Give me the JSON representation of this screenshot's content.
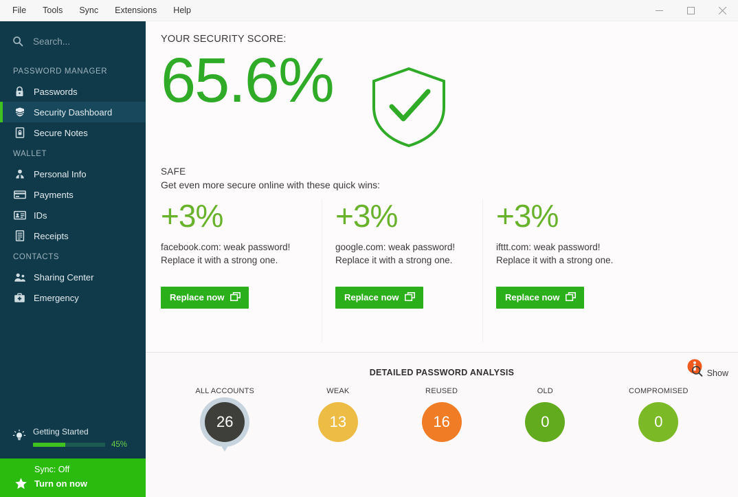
{
  "window": {
    "menu": [
      "File",
      "Tools",
      "Sync",
      "Extensions",
      "Help"
    ],
    "controls": {
      "minimize": "minimize-button",
      "maximize": "maximize-button",
      "close": "close-button"
    }
  },
  "sidebar": {
    "search": {
      "value": "",
      "placeholder": "Search..."
    },
    "sections": [
      {
        "title": "PASSWORD MANAGER",
        "items": [
          {
            "label": "Passwords",
            "icon": "lock-icon",
            "active": false
          },
          {
            "label": "Security Dashboard",
            "icon": "shield-stack-icon",
            "active": true
          },
          {
            "label": "Secure Notes",
            "icon": "note-lock-icon",
            "active": false
          }
        ]
      },
      {
        "title": "WALLET",
        "items": [
          {
            "label": "Personal Info",
            "icon": "person-icon",
            "active": false
          },
          {
            "label": "Payments",
            "icon": "credit-card-icon",
            "active": false
          },
          {
            "label": "IDs",
            "icon": "id-card-icon",
            "active": false
          },
          {
            "label": "Receipts",
            "icon": "receipt-icon",
            "active": false
          }
        ]
      },
      {
        "title": "CONTACTS",
        "items": [
          {
            "label": "Sharing Center",
            "icon": "people-share-icon",
            "active": false
          },
          {
            "label": "Emergency",
            "icon": "emergency-kit-icon",
            "active": false
          }
        ]
      }
    ],
    "getting_started": {
      "label": "Getting Started",
      "percent_label": "45%",
      "percent_value": 45,
      "icon": "lightbulb-icon"
    },
    "sync": {
      "status": "Sync: Off",
      "action": "Turn on now",
      "icon": "star-icon",
      "bg_color": "#2bbb0f"
    }
  },
  "main": {
    "score": {
      "title": "YOUR SECURITY SCORE:",
      "value": "65.6%",
      "status": "SAFE",
      "subtitle": "Get even more secure online with these quick wins:",
      "shield_icon": "shield-check-icon",
      "color": "#2fab27"
    },
    "quick_wins": [
      {
        "percent": "+3%",
        "text": "facebook.com: weak password! Replace it with a strong one.",
        "button_label": "Replace now",
        "button_icon": "open-external-icon"
      },
      {
        "percent": "+3%",
        "text": "google.com: weak password! Replace it with a strong one.",
        "button_label": "Replace now",
        "button_icon": "open-external-icon"
      },
      {
        "percent": "+3%",
        "text": "ifttt.com: weak password! Replace it with a strong one.",
        "button_label": "Replace now",
        "button_icon": "open-external-icon"
      }
    ],
    "analysis": {
      "title": "DETAILED PASSWORD ANALYSIS",
      "show_label": "Show",
      "info_icon": "info-magnifier-icon",
      "metrics": [
        {
          "label": "ALL ACCOUNTS",
          "value": "26",
          "color": "#3e3e3a",
          "ring": true
        },
        {
          "label": "WEAK",
          "value": "13",
          "color": "#ecbc45",
          "ring": false
        },
        {
          "label": "REUSED",
          "value": "16",
          "color": "#f07c26",
          "ring": false
        },
        {
          "label": "OLD",
          "value": "0",
          "color": "#63ab1e",
          "ring": false
        },
        {
          "label": "COMPROMISED",
          "value": "0",
          "color": "#7cb927",
          "ring": false
        }
      ]
    }
  }
}
